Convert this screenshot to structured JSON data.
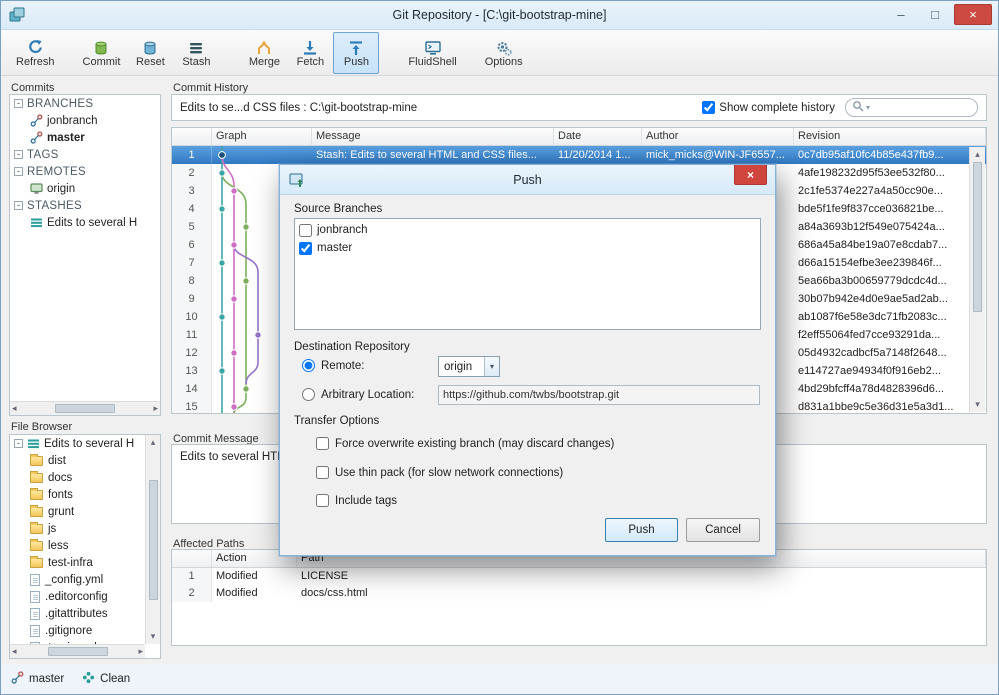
{
  "window": {
    "title": "Git Repository - [C:\\git-bootstrap-mine]",
    "minimize": "–",
    "maximize": "□",
    "close": "×"
  },
  "toolbar": {
    "items": [
      "Refresh",
      "Commit",
      "Reset",
      "Stash",
      "Merge",
      "Fetch",
      "Push",
      "FluidShell",
      "Options"
    ],
    "active": "Push"
  },
  "commits_panel": {
    "title": "Commits",
    "tree": [
      {
        "label": "BRANCHES"
      },
      {
        "label": "jonbranch"
      },
      {
        "label": "master"
      },
      {
        "label": "TAGS"
      },
      {
        "label": "REMOTES"
      },
      {
        "label": "origin"
      },
      {
        "label": "STASHES"
      },
      {
        "label": "Edits to several H"
      }
    ]
  },
  "history": {
    "title": "Commit History",
    "summary": "Edits to se...d CSS files : C:\\git-bootstrap-mine",
    "show_complete_history_label": "Show complete history",
    "columns": [
      "Graph",
      "Message",
      "Date",
      "Author",
      "Revision"
    ],
    "rows": [
      {
        "num": "1",
        "message": "Stash: Edits to several HTML and CSS files...",
        "date": "11/20/2014 1...",
        "author": "mick_micks@WIN-JF6557...",
        "revision": "0c7db95af10fc4b85e437fb9..."
      },
      {
        "num": "2",
        "revision": "4afe198232d95f53ee532f80..."
      },
      {
        "num": "3",
        "revision": "2c1fe5374e227a4a50cc90e..."
      },
      {
        "num": "4",
        "revision": "bde5f1fe9f837cce036821be..."
      },
      {
        "num": "5",
        "revision": "a84a3693b12f549e075424a..."
      },
      {
        "num": "6",
        "revision": "686a45a84be19a07e8cdab7..."
      },
      {
        "num": "7",
        "revision": "d66a15154efbe3ee239846f..."
      },
      {
        "num": "8",
        "revision": "5ea66ba3b00659779dcdc4d..."
      },
      {
        "num": "9",
        "revision": "30b07b942e4d0e9ae5ad2ab..."
      },
      {
        "num": "10",
        "revision": "ab1087f6e58e3dc71fb2083c..."
      },
      {
        "num": "11",
        "revision": "f2eff55064fed7cce93291da..."
      },
      {
        "num": "12",
        "revision": "05d4932cadbcf5a7148f2648..."
      },
      {
        "num": "13",
        "revision": "e114727ae94934f0f916eb2..."
      },
      {
        "num": "14",
        "revision": "4bd29bfcff4a78d4828396d6..."
      },
      {
        "num": "15",
        "revision": "d831a1bbe9c5e36d31e5a3d1..."
      }
    ]
  },
  "commit_message": {
    "title": "Commit Message",
    "text": "Edits to several HTML"
  },
  "affected_paths": {
    "title": "Affected Paths",
    "columns": [
      "Action",
      "Path"
    ],
    "rows": [
      {
        "num": "1",
        "action": "Modified",
        "path": "LICENSE"
      },
      {
        "num": "2",
        "action": "Modified",
        "path": "docs/css.html"
      }
    ]
  },
  "file_browser": {
    "title": "File Browser",
    "root": "Edits to several H",
    "folders": [
      "dist",
      "docs",
      "fonts",
      "grunt",
      "js",
      "less",
      "test-infra"
    ],
    "files": [
      "_config.yml",
      ".editorconfig",
      ".gitattributes",
      ".gitignore",
      ".travis.yml"
    ]
  },
  "status_bar": {
    "branch": "master",
    "state": "Clean"
  },
  "push_dialog": {
    "title": "Push",
    "source_branches_label": "Source Branches",
    "branches": [
      {
        "label": "jonbranch",
        "checked": false
      },
      {
        "label": "master",
        "checked": true
      }
    ],
    "destination_label": "Destination Repository",
    "remote_label": "Remote:",
    "remote_value": "origin",
    "arbitrary_label": "Arbitrary Location:",
    "arbitrary_value": "https://github.com/twbs/bootstrap.git",
    "transfer_label": "Transfer Options",
    "options": [
      "Force overwrite existing branch (may discard changes)",
      "Use thin pack (for slow network connections)",
      "Include tags"
    ],
    "push_label": "Push",
    "cancel_label": "Cancel"
  },
  "colors": {
    "selection_blue": "#3078c2",
    "close_red": "#cc4a42",
    "accent_blue": "#2e7bb5",
    "graph_lines": [
      "#3aa6a6",
      "#cf6ec4",
      "#7cae5c",
      "#9673c9"
    ]
  }
}
